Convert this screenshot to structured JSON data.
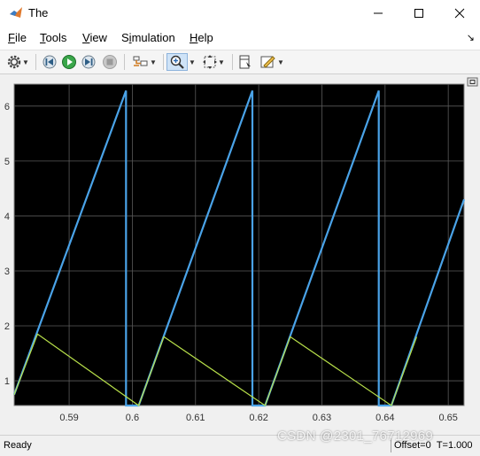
{
  "window": {
    "title": "The"
  },
  "menu": [
    {
      "label": "File",
      "mnemonic": "F",
      "rest": "ile"
    },
    {
      "label": "Tools",
      "mnemonic": "T",
      "rest": "ools"
    },
    {
      "label": "View",
      "mnemonic": "V",
      "rest": "iew"
    },
    {
      "label": "Simulation",
      "mnemonic": "i",
      "rest_before": "S",
      "rest": "mulation"
    },
    {
      "label": "Help",
      "mnemonic": "H",
      "rest": "elp"
    }
  ],
  "toolbar": {
    "icons": [
      "settings-icon",
      "step-back-icon",
      "run-icon",
      "step-forward-icon",
      "stop-icon",
      "signal-selector-icon",
      "zoom-in-icon",
      "fit-to-view-icon",
      "cursor-measure-icon",
      "style-icon"
    ]
  },
  "status": {
    "ready": "Ready",
    "offset": "Offset=0",
    "time": "T=1.000"
  },
  "watermark": "CSDN @2301_76712969",
  "chart_data": {
    "type": "line",
    "title": "",
    "xlabel": "",
    "ylabel": "",
    "xlim": [
      0.5813,
      0.6525
    ],
    "ylim": [
      0.55,
      6.4
    ],
    "xticks": [
      "0.59",
      "0.6",
      "0.61",
      "0.62",
      "0.63",
      "0.64",
      "0.65"
    ],
    "xtick_values": [
      0.59,
      0.6,
      0.61,
      0.62,
      0.63,
      0.64,
      0.65
    ],
    "yticks": [
      "1",
      "2",
      "3",
      "4",
      "5",
      "6"
    ],
    "ytick_values": [
      1,
      2,
      3,
      4,
      5,
      6
    ],
    "grid": true,
    "background": "#000000",
    "series": [
      {
        "color": "#4aa3e8",
        "x": [
          0.5813,
          0.599,
          0.599,
          0.601,
          0.619,
          0.619,
          0.621,
          0.639,
          0.639,
          0.641,
          0.6525
        ],
        "y": [
          0.75,
          6.28,
          0.55,
          0.55,
          6.28,
          0.55,
          0.55,
          6.28,
          0.55,
          0.55,
          4.3
        ]
      },
      {
        "color": "#b8e04a",
        "x": [
          0.5813,
          0.585,
          0.601,
          0.605,
          0.621,
          0.625,
          0.641,
          0.645
        ],
        "y": [
          0.75,
          1.85,
          0.55,
          1.8,
          0.55,
          1.8,
          0.55,
          1.8
        ]
      }
    ]
  }
}
